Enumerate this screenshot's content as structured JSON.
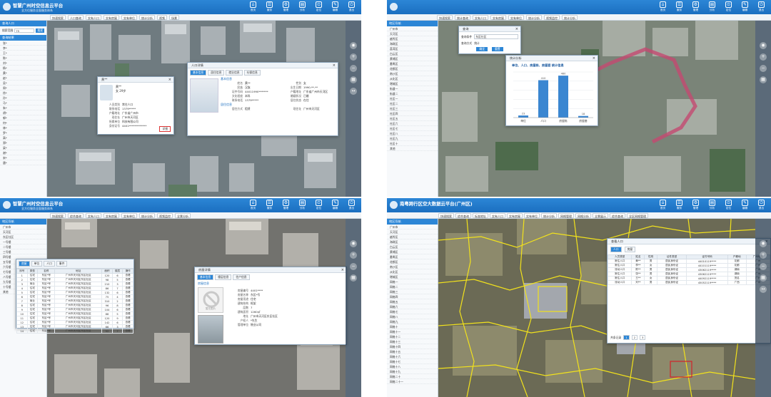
{
  "app": {
    "title_a": "智慧广州时空信息云平台",
    "subtitle_a": "全方位服务全面服务体系",
    "title_b": "南粤跨行区空大数据云平台(广州区)",
    "nav": [
      "首页",
      "服务",
      "管理",
      "分析",
      "定位",
      "编辑",
      "退出"
    ]
  },
  "q1": {
    "toolbar": [
      "快速搜索",
      "人口查询",
      "实有人口",
      "实有房屋",
      "实有单位",
      "统计分析",
      "视频",
      "场景"
    ],
    "side_header": "查询人口",
    "search_label": "搜索范围",
    "search_value": "75",
    "search_button": "搜索",
    "list_header": "查询结果",
    "list": [
      "张*",
      "李*",
      "王*",
      "陈*",
      "刘*",
      "杨*",
      "黄*",
      "赵*",
      "吴*",
      "周*",
      "徐*",
      "孙*",
      "马*",
      "朱*",
      "胡*",
      "郭*",
      "何*",
      "林*",
      "罗*",
      "高*",
      "郑*",
      "梁*",
      "谢*",
      "宋*",
      "唐*"
    ],
    "card": {
      "name": "黄**",
      "age_line": "女 29岁",
      "fields": [
        {
          "k": "人员类别",
          "v": "常住人口"
        },
        {
          "k": "联系电话",
          "v": "1379*****"
        },
        {
          "k": "户籍地址",
          "v": "广东省广州市"
        },
        {
          "k": "现住址",
          "v": "广州市天河区"
        },
        {
          "k": "所属单位",
          "v": "科技有限公司"
        },
        {
          "k": "身份证号",
          "v": "4401*************"
        }
      ],
      "button": "详细"
    },
    "detail": {
      "title": "人口详情",
      "tabs": [
        "基本信息",
        "居住信息",
        "就业信息",
        "社保信息"
      ],
      "section": "基本信息",
      "fields": [
        {
          "k": "姓名",
          "v": "黄**"
        },
        {
          "k": "性别",
          "v": "女"
        },
        {
          "k": "民族",
          "v": "汉族"
        },
        {
          "k": "出生日期",
          "v": "1990-**-**"
        },
        {
          "k": "证件号码",
          "v": "44011990*******"
        },
        {
          "k": "户籍地址",
          "v": "广东省广州市天河区"
        },
        {
          "k": "文化程度",
          "v": "本科"
        },
        {
          "k": "婚姻状况",
          "v": "已婚"
        },
        {
          "k": "联系电话",
          "v": "1379*****"
        },
        {
          "k": "居住状态",
          "v": "在住"
        }
      ],
      "section2": "居住信息",
      "fields2": [
        {
          "k": "居住方式",
          "v": "租赁"
        },
        {
          "k": "现住址",
          "v": "广州市天河区"
        }
      ]
    }
  },
  "q2": {
    "toolbar": [
      "快速搜索",
      "统计查询",
      "实有人口",
      "实有房屋",
      "实有单位",
      "统计分析",
      "视频监控",
      "统计分析"
    ],
    "side_header": "地区导航",
    "tree": [
      "广州市",
      "天河区",
      "越秀区",
      "海珠区",
      "荔湾区",
      "白云区",
      "黄埔区",
      "番禺区",
      "花都区",
      "南沙区",
      "从化区",
      "增城区",
      "街道一",
      "街道二",
      "社区一",
      "社区二",
      "社区三",
      "社区四",
      "社区五",
      "社区六",
      "社区七",
      "社区八",
      "社区九",
      "社区十",
      "其他"
    ],
    "query": {
      "title": "查询",
      "label1": "查询条件",
      "value1": "东区社区",
      "label2": "查询方式",
      "value2": "统计",
      "btn_ok": "确定",
      "btn_cancel": "重置"
    },
    "chart_win_title": "统计分析",
    "chart_data": {
      "type": "bar",
      "title": "单位、人口、房屋栋、房屋套 统计信息",
      "categories": [
        "单位",
        "人口",
        "房屋栋",
        "房屋套"
      ],
      "values": [
        23,
        410,
        460,
        18
      ],
      "data_labels": [
        "23",
        "410",
        "460",
        "18"
      ],
      "ylim": [
        0,
        500
      ],
      "grid": true,
      "color": "#3a86d1"
    }
  },
  "q3": {
    "toolbar": [
      "快速搜索",
      "综合查询",
      "实有人口",
      "实有房屋",
      "实有单位",
      "统计分析",
      "视频监控",
      "全景分析"
    ],
    "side_header": "地区导航",
    "tree": [
      "广州市",
      "天河区",
      "东区社区",
      "一号楼",
      "二号楼",
      "三号楼",
      "四号楼",
      "五号楼",
      "六号楼",
      "七号楼",
      "八号楼",
      "九号楼",
      "十号楼",
      "其他"
    ],
    "table": {
      "tabs": [
        "房屋",
        "单位",
        "人口",
        "事件"
      ],
      "headers": [
        "序号",
        "类型",
        "名称",
        "地址",
        "面积",
        "楼层",
        "操作"
      ],
      "rows": [
        [
          "1",
          "住宅",
          "东区*号",
          "广州市天河区东区社区",
          "120",
          "6",
          "查看"
        ],
        [
          "2",
          "住宅",
          "东区*号",
          "广州市天河区东区社区",
          "98",
          "5",
          "查看"
        ],
        [
          "3",
          "商业",
          "东区*号",
          "广州市天河区东区社区",
          "210",
          "3",
          "查看"
        ],
        [
          "4",
          "住宅",
          "东区*号",
          "广州市天河区东区社区",
          "86",
          "7",
          "查看"
        ],
        [
          "5",
          "住宅",
          "东区*号",
          "广州市天河区东区社区",
          "132",
          "6",
          "查看"
        ],
        [
          "6",
          "住宅",
          "东区*号",
          "广州市天河区东区社区",
          "75",
          "4",
          "查看"
        ],
        [
          "7",
          "商业",
          "东区*号",
          "广州市天河区东区社区",
          "310",
          "2",
          "查看"
        ],
        [
          "8",
          "住宅",
          "东区*号",
          "广州市天河区东区社区",
          "96",
          "8",
          "查看"
        ],
        [
          "9",
          "住宅",
          "东区*号",
          "广州市天河区东区社区",
          "104",
          "6",
          "查看"
        ],
        [
          "10",
          "住宅",
          "东区*号",
          "广州市天河区东区社区",
          "88",
          "5",
          "查看"
        ],
        [
          "11",
          "住宅",
          "东区*号",
          "广州市天河区东区社区",
          "120",
          "9",
          "查看"
        ],
        [
          "12",
          "住宅",
          "东区*号",
          "广州市天河区东区社区",
          "142",
          "6",
          "查看"
        ],
        [
          "13",
          "住宅",
          "东区*号",
          "广州市天河区东区社区",
          "66",
          "3",
          "查看"
        ],
        [
          "14",
          "住宅",
          "东区*号",
          "广州市天河区东区社区",
          "92",
          "7",
          "查看"
        ]
      ]
    },
    "house": {
      "title": "房屋详情",
      "tabs": [
        "基本信息",
        "楼层信息",
        "住户信息"
      ],
      "section": "房屋信息",
      "noimg": "暂无图片",
      "fields": [
        {
          "k": "房屋编号",
          "v": "4401****"
        },
        {
          "k": "房屋名称",
          "v": "东区*号"
        },
        {
          "k": "房屋用途",
          "v": "住宅"
        },
        {
          "k": "建筑结构",
          "v": "框架"
        },
        {
          "k": "层数",
          "v": "7"
        },
        {
          "k": "建筑面积",
          "v": "1260㎡"
        },
        {
          "k": "地址",
          "v": "广州市天河区东区社区"
        },
        {
          "k": "产权人",
          "v": "*先生"
        },
        {
          "k": "管理单位",
          "v": "物业公司"
        }
      ]
    }
  },
  "q4": {
    "toolbar": [
      "快速搜索",
      "综合查询",
      "标准地址",
      "实有人口",
      "实有房屋",
      "实有单位",
      "统计分析",
      "网格管理",
      "网格分析",
      "全景展示",
      "综合查询",
      "全区网格管理"
    ],
    "side_header": "地区导航",
    "tree": [
      "广州市",
      "天河区",
      "越秀区",
      "海珠区",
      "白云区",
      "黄埔区",
      "番禺区",
      "花都区",
      "南沙区",
      "从化区",
      "增城区",
      "网格一",
      "网格二",
      "网格三",
      "网格四",
      "网格五",
      "网格六",
      "网格七",
      "网格八",
      "网格九",
      "网格十",
      "网格十一",
      "网格十二",
      "网格十三",
      "网格十四",
      "网格十五",
      "网格十六",
      "网格十七",
      "网格十八",
      "网格十九",
      "网格二十",
      "网格二十一"
    ],
    "popup": {
      "title": "查看人口",
      "tabs": [
        "人口",
        "房屋"
      ],
      "headers": [
        "人员类型",
        "姓名",
        "性别",
        "证件类型",
        "证件号码",
        "户籍地",
        "广州地址"
      ],
      "rows": [
        [
          "常住人口",
          "黄**",
          "男",
          "居民身份证",
          "44010119****",
          "花都",
          "广州"
        ],
        [
          "常住人口",
          "李**",
          "女",
          "居民身份证",
          "44101119****",
          "花都",
          "广州"
        ],
        [
          "流动人口",
          "陈**",
          "男",
          "居民身份证",
          "43062119****",
          "湖南",
          "广州"
        ],
        [
          "常住人口",
          "张**",
          "男",
          "居民身份证",
          "43062119****",
          "湖南",
          "广州"
        ],
        [
          "常住人口",
          "王**",
          "女",
          "居民身份证",
          "44092119****",
          "茂名",
          "广州"
        ],
        [
          "流动人口",
          "刘**",
          "男",
          "居民身份证",
          "45052119****",
          "广西",
          "广州"
        ]
      ],
      "pager_label": "共条记录",
      "pages": [
        "1",
        "2",
        "3"
      ]
    }
  }
}
